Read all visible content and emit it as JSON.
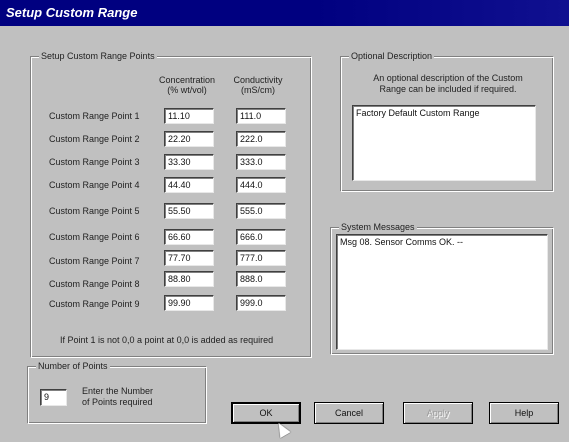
{
  "window": {
    "title": "Setup Custom Range"
  },
  "points_group": {
    "title": "Setup Custom Range Points",
    "col_concentration": [
      "Concentration",
      "(% wt/vol)"
    ],
    "col_conductivity": [
      "Conductivity",
      "(mS/cm)"
    ],
    "rows": [
      {
        "label": "Custom Range Point 1",
        "concentration": "11.10",
        "conductivity": "111.0"
      },
      {
        "label": "Custom Range Point 2",
        "concentration": "22.20",
        "conductivity": "222.0"
      },
      {
        "label": "Custom Range Point 3",
        "concentration": "33.30",
        "conductivity": "333.0"
      },
      {
        "label": "Custom Range Point 4",
        "concentration": "44.40",
        "conductivity": "444.0"
      },
      {
        "label": "Custom Range Point 5",
        "concentration": "55.50",
        "conductivity": "555.0"
      },
      {
        "label": "Custom Range Point 6",
        "concentration": "66.60",
        "conductivity": "666.0"
      },
      {
        "label": "Custom Range Point 7",
        "concentration": "77.70",
        "conductivity": "777.0"
      },
      {
        "label": "Custom Range Point 8",
        "concentration": "88.80",
        "conductivity": "888.0"
      },
      {
        "label": "Custom Range Point 9",
        "concentration": "99.90",
        "conductivity": "999.0"
      }
    ],
    "note": "If Point 1 is not 0,0 a point at 0,0 is added as required"
  },
  "description_group": {
    "title": "Optional Description",
    "hint_line1": "An optional description of the Custom",
    "hint_line2": "Range can be included if required.",
    "value": "Factory Default Custom Range"
  },
  "messages_group": {
    "title": "System Messages",
    "value": "Msg 08. Sensor Comms OK. --"
  },
  "points_count_group": {
    "title": "Number of Points",
    "value": "9",
    "hint_line1": "Enter the Number",
    "hint_line2": "of Points required"
  },
  "buttons": {
    "ok": "OK",
    "cancel": "Cancel",
    "apply": "Apply",
    "help": "Help"
  }
}
